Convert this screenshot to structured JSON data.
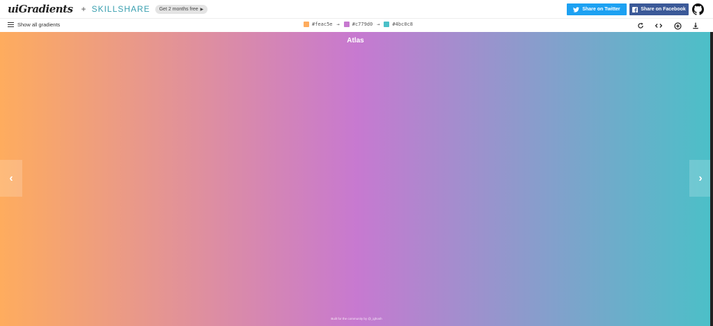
{
  "brand": {
    "logo": "uiGradients",
    "plus": "+",
    "partner": "SKILLSHARE",
    "promo_label": "Get 2 months free",
    "promo_arrow": "▶"
  },
  "share": {
    "twitter_label": "Share on Twitter",
    "facebook_label": "Share on Facebook"
  },
  "toolbar": {
    "menu_label": "Show all gradients",
    "arrow": "→",
    "colors": [
      {
        "hex": "#feac5e",
        "label": "#feac5e"
      },
      {
        "hex": "#c779d0",
        "label": "#c779d0"
      },
      {
        "hex": "#4bc0c8",
        "label": "#4bc0c8"
      }
    ],
    "icons": [
      "refresh-icon",
      "code-icon",
      "add-icon",
      "download-icon"
    ]
  },
  "gradient": {
    "name": "Atlas",
    "stops": [
      "#feac5e",
      "#c779d0",
      "#4bc0c8"
    ]
  },
  "nav": {
    "prev_glyph": "‹",
    "next_glyph": "›"
  },
  "footer": {
    "text": "Built for the community by @_ighosh"
  }
}
